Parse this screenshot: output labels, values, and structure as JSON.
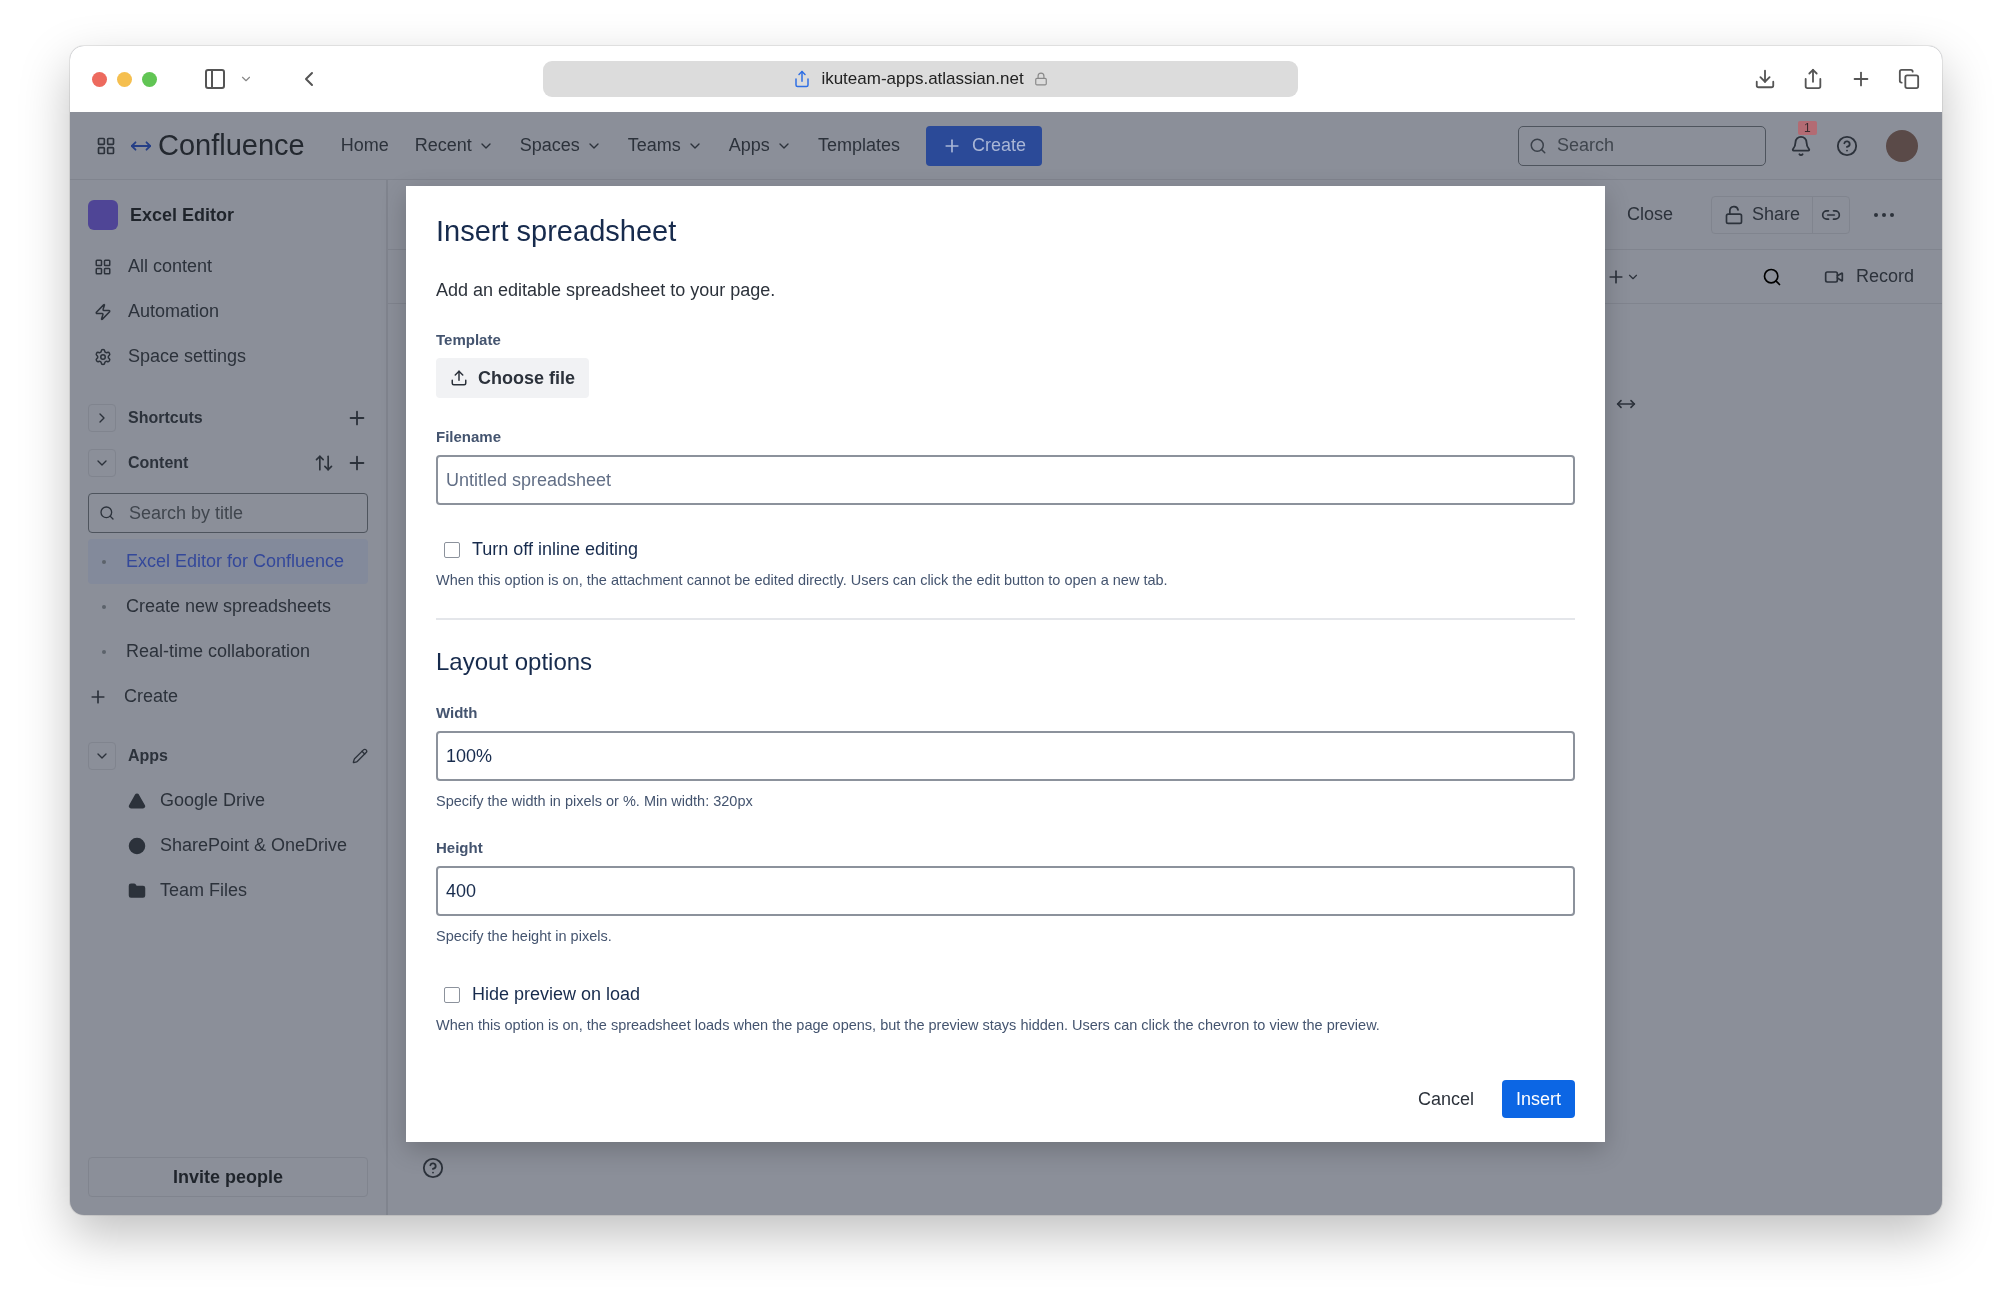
{
  "browser": {
    "url": "ikuteam-apps.atlassian.net"
  },
  "header": {
    "product": "Confluence",
    "nav": [
      {
        "label": "Home",
        "dropdown": false
      },
      {
        "label": "Recent",
        "dropdown": true
      },
      {
        "label": "Spaces",
        "dropdown": true
      },
      {
        "label": "Teams",
        "dropdown": true
      },
      {
        "label": "Apps",
        "dropdown": true
      },
      {
        "label": "Templates",
        "dropdown": false
      }
    ],
    "create": "Create",
    "search": {
      "placeholder": "Search"
    },
    "notifications": "1"
  },
  "sidebar": {
    "space": "Excel Editor",
    "items": [
      "All content",
      "Automation",
      "Space settings"
    ],
    "shortcuts": {
      "label": "Shortcuts",
      "expanded": false
    },
    "content": {
      "label": "Content",
      "expanded": true
    },
    "search": {
      "placeholder": "Search by title"
    },
    "pages": [
      {
        "title": "Excel Editor for Confluence",
        "selected": true
      },
      {
        "title": "Create new spreadsheets",
        "selected": false
      },
      {
        "title": "Real-time collaboration",
        "selected": false
      }
    ],
    "create": "Create",
    "apps": {
      "label": "Apps",
      "expanded": true,
      "items": [
        "Google Drive",
        "SharePoint & OneDrive",
        "Team Files"
      ]
    },
    "invite": "Invite people"
  },
  "toolbar": {
    "close": "Close",
    "share": "Share",
    "record": "Record"
  },
  "dialog": {
    "title": "Insert spreadsheet",
    "description": "Add an editable spreadsheet to your page.",
    "template": {
      "label": "Template",
      "button": "Choose file"
    },
    "filename": {
      "label": "Filename",
      "placeholder": "Untitled spreadsheet"
    },
    "inline_editing": {
      "label": "Turn off inline editing",
      "checked": false,
      "hint": "When this option is on, the attachment cannot be edited directly. Users can click the edit button to open a new tab."
    },
    "layout_heading": "Layout options",
    "width": {
      "label": "Width",
      "value": "100%",
      "hint": "Specify the width in pixels or %. Min width: 320px"
    },
    "height": {
      "label": "Height",
      "value": "400",
      "hint": "Specify the height in pixels."
    },
    "hide_preview": {
      "label": "Hide preview on load",
      "checked": false,
      "hint": "When this option is on, the spreadsheet loads when the page opens, but the preview stays hidden. Users can click the chevron to view the preview."
    },
    "cancel": "Cancel",
    "insert": "Insert"
  }
}
